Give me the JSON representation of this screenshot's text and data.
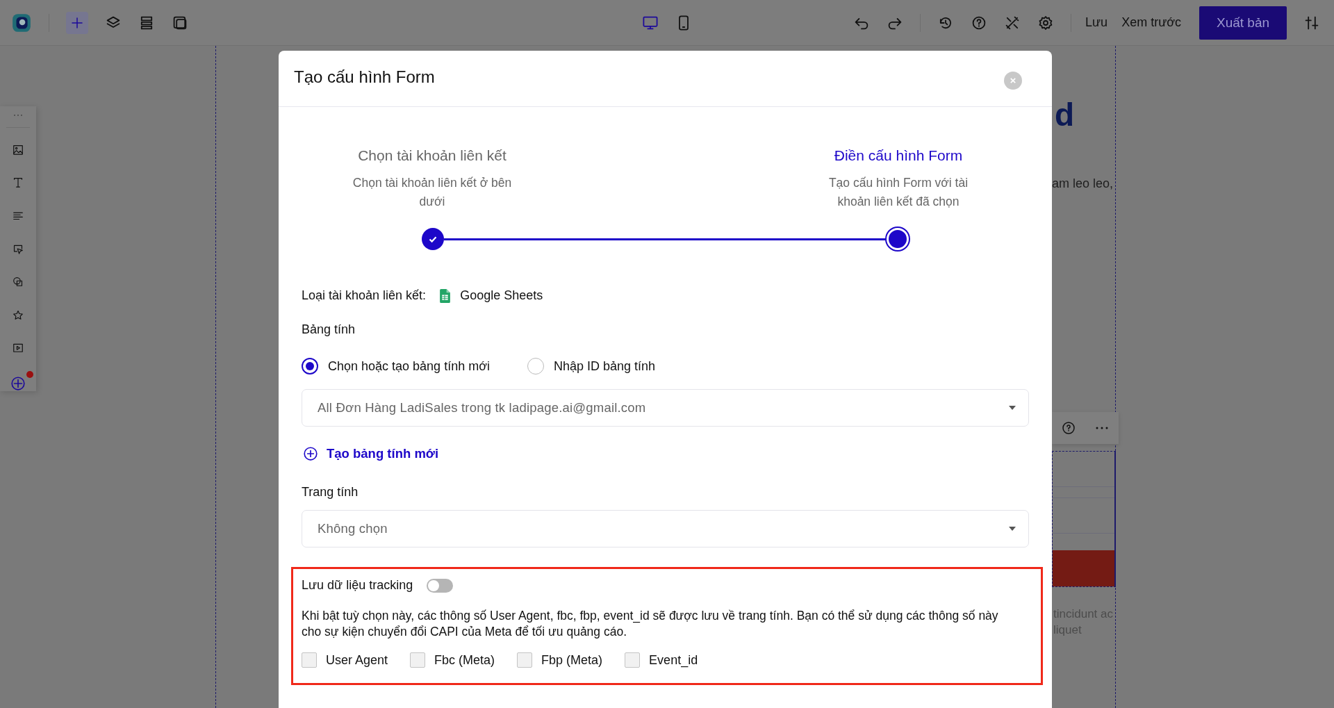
{
  "top_bar": {
    "devices": [
      {
        "kind": "desktop",
        "selected": true
      },
      {
        "kind": "tablet",
        "selected": false
      }
    ],
    "save": "Lưu",
    "preview": "Xem trước",
    "publish": "Xuất bản"
  },
  "background": {
    "heading_fragment": "d",
    "text_fragment": "am leo leo,",
    "caption_lines": [
      "tincidunt ac",
      "liquet"
    ]
  },
  "modal": {
    "title": "Tạo cấu hình Form",
    "steps": [
      {
        "title": "Chọn tài khoản liên kết",
        "description": "Chọn tài khoản liên kết ở bên dưới",
        "done": true,
        "selected": false
      },
      {
        "title": "Điền cấu hình Form",
        "description": "Tạo cấu hình Form với tài khoản liên kết đã chọn",
        "done": false,
        "selected": true
      }
    ],
    "account_type": {
      "label": "Loại tài khoản liên kết:",
      "value": "Google Sheets"
    },
    "spreadsheet": {
      "label": "Bảng tính",
      "options": [
        {
          "label": "Chọn hoặc tạo bảng tính mới",
          "selected": true
        },
        {
          "label": "Nhập ID bảng tính",
          "selected": false
        }
      ],
      "value": "All Đơn Hàng LadiSales trong tk ladipage.ai@gmail.com",
      "create_link": "Tạo bảng tính mới"
    },
    "sheet": {
      "label": "Trang tính",
      "value": "Không chọn"
    },
    "tracking": {
      "label": "Lưu dữ liệu tracking",
      "on": false,
      "description": "Khi bật tuỳ chọn này, các thông số User Agent, fbc, fbp, event_id sẽ được lưu về trang tính. Bạn có thể sử dụng các thông số này cho sự kiện chuyển đổi CAPI của Meta để tối ưu quảng cáo.",
      "fields": [
        {
          "label": "User Agent",
          "checked": false
        },
        {
          "label": "Fbc (Meta)",
          "checked": false
        },
        {
          "label": "Fbp (Meta)",
          "checked": false
        },
        {
          "label": "Event_id",
          "checked": false
        }
      ]
    }
  }
}
